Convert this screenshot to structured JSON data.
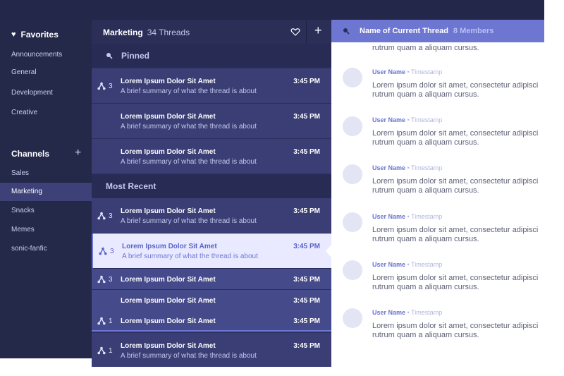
{
  "sidebar": {
    "favorites_label": "Favorites",
    "favorites": [
      "Announcements",
      "General",
      "Development",
      "Creative"
    ],
    "channels_label": "Channels",
    "channels": [
      "Sales",
      "Marketing",
      "Snacks",
      "Memes",
      "sonic-fanfic"
    ],
    "active_channel": "Marketing"
  },
  "threads": {
    "channel": "Marketing",
    "count": "34 Threads",
    "pinned_label": "Pinned",
    "recent_label": "Most Recent",
    "pinned": [
      {
        "badge": "3",
        "title": "Lorem Ipsum Dolor Sit Amet",
        "summary": "A brief summary of what the thread is about",
        "time": "3:45 PM"
      },
      {
        "badge": "",
        "title": "Lorem Ipsum Dolor Sit Amet",
        "summary": "A brief summary of what the thread is about",
        "time": "3:45 PM"
      },
      {
        "badge": "",
        "title": "Lorem Ipsum Dolor Sit Amet",
        "summary": "A brief summary of what the thread is about",
        "time": "3:45 PM"
      }
    ],
    "recent": [
      {
        "badge": "3",
        "title": "Lorem Ipsum Dolor Sit Amet",
        "summary": "A brief summary of what the thread is about",
        "time": "3:45 PM"
      },
      {
        "badge": "3",
        "title": "Lorem Ipsum Dolor Sit Amet",
        "summary": "A brief summary of what the thread is about",
        "time": "3:45 PM"
      },
      {
        "badge": "3",
        "title": "Lorem Ipsum Dolor Sit Amet",
        "time": "3:45 PM"
      },
      {
        "badge": "",
        "title": "Lorem Ipsum Dolor Sit Amet",
        "time": "3:45 PM"
      },
      {
        "badge": "1",
        "title": "Lorem Ipsum Dolor Sit Amet",
        "time": "3:45 PM"
      },
      {
        "badge": "1",
        "title": "Lorem Ipsum Dolor Sit Amet",
        "summary": "A brief summary of what the thread is about",
        "time": "3:45 PM"
      }
    ]
  },
  "conversation": {
    "title": "Name of Current Thread",
    "members": "8 Members",
    "top_fragment": "rutrum quam a aliquam cursus.",
    "messages": [
      {
        "user": "User Name",
        "timestamp": "• Timestamp",
        "line1": "Lorem ipsum dolor sit amet, consectetur adipisci",
        "line2": "rutrum quam a aliquam cursus."
      },
      {
        "user": "User Name",
        "timestamp": "• Timestamp",
        "line1": "Lorem ipsum dolor sit amet, consectetur adipisci",
        "line2": "rutrum quam a aliquam cursus."
      },
      {
        "user": "User Name",
        "timestamp": "• Timestamp",
        "line1": "Lorem ipsum dolor sit amet, consectetur adipisci",
        "line2": "rutrum quam a aliquam cursus."
      },
      {
        "user": "User Name",
        "timestamp": "• Timestamp",
        "line1": "Lorem ipsum dolor sit amet, consectetur adipisci",
        "line2": "rutrum quam a aliquam cursus."
      },
      {
        "user": "User Name",
        "timestamp": "• Timestamp",
        "line1": "Lorem ipsum dolor sit amet, consectetur adipisci",
        "line2": "rutrum quam a aliquam cursus."
      },
      {
        "user": "User Name",
        "timestamp": "• Timestamp",
        "line1": "Lorem ipsum dolor sit amet, consectetur adipisci",
        "line2": "rutrum quam a aliquam cursus."
      }
    ]
  },
  "colors": {
    "sidebar": "#242849",
    "accent": "#6d76d1",
    "selected": "#e9eaff"
  }
}
